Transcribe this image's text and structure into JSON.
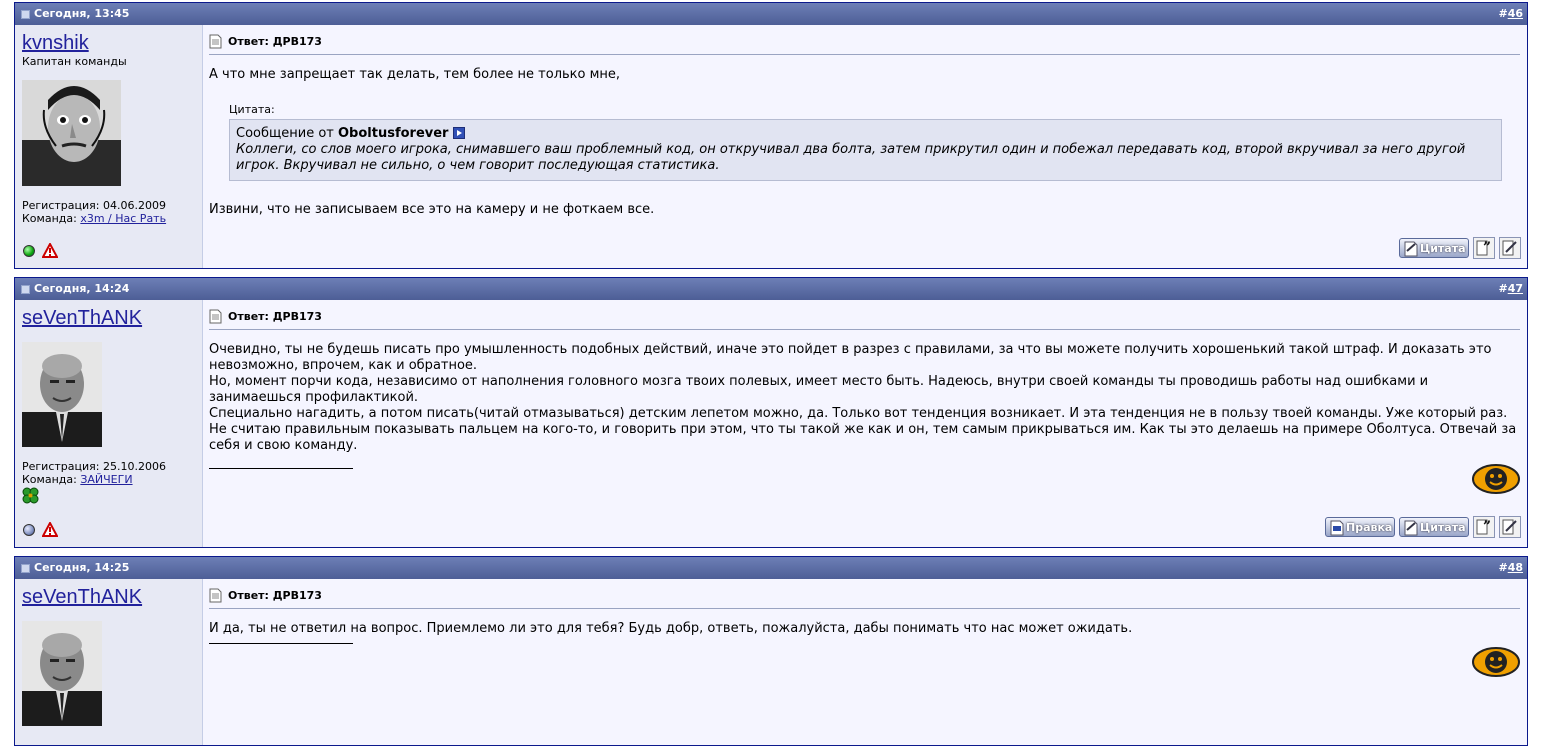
{
  "posts": [
    {
      "date": "Сегодня, 13:45",
      "number_prefix": "#",
      "number": "46",
      "username": "kvnshik",
      "user_title": "Капитан команды",
      "reg_label": "Регистрация:",
      "reg_date": "04.06.2009",
      "team_label": "Команда:",
      "team": "x3m / Нас Рать",
      "status": "online",
      "title": "Ответ: ДРВ173",
      "text_before_quote": "А что мне запрещает так делать, тем более не только мне,",
      "quote": {
        "label": "Цитата:",
        "from_prefix": "Сообщение от",
        "author": "Oboltusforever",
        "text": "Коллеги, со слов моего игрока, снимавшего ваш проблемный код, он откручивал два болта, затем прикрутил один и побежал передавать код, второй вкручивал за него другой игрок. Вкручивал не сильно, о чем говорит последующая статистика."
      },
      "text_after_quote": "Извини, что не записываем все это на камеру и не фоткаем все.",
      "buttons": {
        "quote": "Цитата"
      }
    },
    {
      "date": "Сегодня, 14:24",
      "number_prefix": "#",
      "number": "47",
      "username": "seVenThANK",
      "reg_label": "Регистрация:",
      "reg_date": "25.10.2006",
      "team_label": "Команда:",
      "team": "ЗАЙЧЕГИ",
      "status": "offline",
      "title": "Ответ: ДРВ173",
      "text": [
        "Очевидно, ты не будешь писать про умышленность подобных действий, иначе это пойдет в разрез с правилами, за что вы можете получить хорошенький такой штраф. И доказать это невозможно, впрочем, как и обратное.",
        "Но, момент порчи кода, независимо от наполнения головного мозга твоих полевых, имеет место быть. Надеюсь, внутри своей команды ты проводишь работы над ошибками и занимаешься профилактикой.",
        "Специально нагадить, а потом писать(читай отмазываться) детским лепетом можно, да. Только вот тенденция возникает. И эта тенденция не в пользу твоей команды. Уже который раз.",
        "Не считаю правильным показывать пальцем на кого-то, и говорить при этом, что ты такой же как и он, тем самым прикрываться им. Как ты это делаешь на примере Оболтуса. Отвечай за себя и свою команду."
      ],
      "buttons": {
        "edit": "Правка",
        "quote": "Цитата"
      }
    },
    {
      "date": "Сегодня, 14:25",
      "number_prefix": "#",
      "number": "48",
      "username": "seVenThANK",
      "title": "Ответ: ДРВ173",
      "text": "И да, ты не ответил на вопрос. Приемлемо ли это для тебя? Будь добр, ответь, пожалуйста, дабы понимать что нас может ожидать."
    }
  ],
  "icons": {
    "post_icon": "post-icon",
    "title_icon": "document-icon",
    "online": "online-dot-icon",
    "offline": "offline-dot-icon",
    "report": "report-warning-icon",
    "multiquote": "multiquote-icon",
    "quick_reply": "quick-reply-icon",
    "signature": "watchmen-smiley-icon",
    "clover": "clover-icon"
  }
}
